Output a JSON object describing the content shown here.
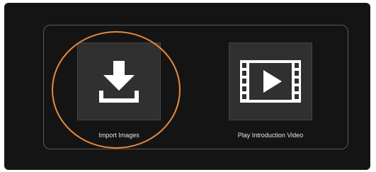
{
  "options": {
    "import": {
      "label": "Import Images",
      "icon": "download-icon"
    },
    "play": {
      "label": "Play Introduction Video",
      "icon": "film-play-icon"
    }
  },
  "colors": {
    "window_bg": "#141414",
    "tile_bg": "#303030",
    "panel_border": "#5a5a5a",
    "highlight": "#e8893c",
    "icon": "#ffffff"
  }
}
